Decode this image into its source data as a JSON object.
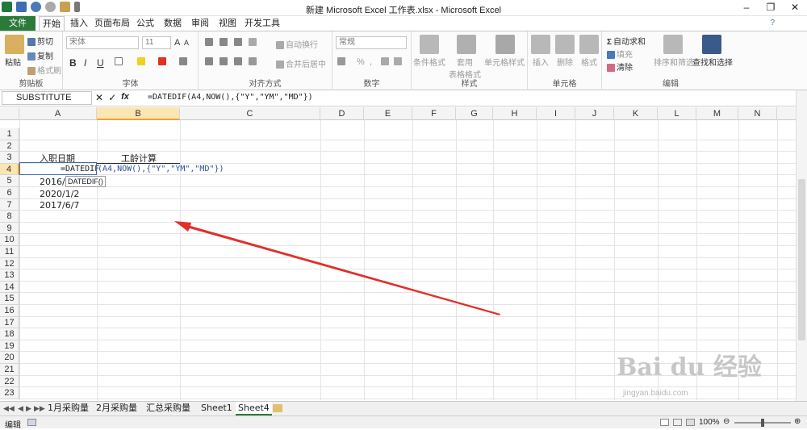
{
  "window": {
    "title": "新建 Microsoft Excel 工作表.xlsx - Microsoft Excel",
    "controls": [
      "–",
      "❐",
      "✕"
    ]
  },
  "ribbon_tabs": {
    "file": "文件",
    "tabs": [
      "开始",
      "插入",
      "页面布局",
      "公式",
      "数据",
      "审阅",
      "视图",
      "开发工具"
    ],
    "active": "开始"
  },
  "clipboard": {
    "paste": "粘贴",
    "cut": "剪切",
    "copy": "复制",
    "format_painter": "格式刷",
    "group": "剪贴板"
  },
  "font": {
    "name": "宋体",
    "size": "11",
    "bold": "B",
    "italic": "I",
    "underline": "U",
    "grow": "A",
    "shrink": "A",
    "group": "字体"
  },
  "alignment": {
    "wrap": "自动换行",
    "merge": "合并后居中",
    "group": "对齐方式"
  },
  "number": {
    "format": "常规",
    "percent": "%",
    "comma": ",",
    "group": "数字"
  },
  "styles": {
    "conditional": "条件格式",
    "table": "套用\n表格格式",
    "cell": "单元格样式",
    "group": "样式"
  },
  "cells": {
    "insert": "插入",
    "delete": "删除",
    "format": "格式",
    "group": "单元格"
  },
  "editing": {
    "autosum": "自动求和",
    "fill": "填充",
    "clear": "清除",
    "sort": "排序和筛选",
    "find": "查找和选择",
    "group": "编辑"
  },
  "formula_bar": {
    "name_box": "SUBSTITUTE",
    "fx": "fx",
    "formula": "=DATEDIF(A4,NOW(),{\"Y\",\"YM\",\"MD\"})"
  },
  "columns": [
    "A",
    "B",
    "C",
    "D",
    "E",
    "F",
    "G",
    "H",
    "I",
    "J",
    "K",
    "L",
    "M",
    "N"
  ],
  "rows": [
    "1",
    "2",
    "3",
    "4",
    "5",
    "6",
    "7",
    "8",
    "9",
    "10",
    "11",
    "12",
    "13",
    "14",
    "15",
    "16",
    "17",
    "18",
    "19",
    "20",
    "21",
    "22",
    "23"
  ],
  "cells_data": {
    "a3": "入职日期",
    "b3": "工龄计算",
    "a4_formula_start": "=DATEDIF",
    "a4_formula_rest": "(A4,NOW(),{\"Y\",\"YM\",\"MD\"})",
    "a5": "2016/4",
    "a6": "2020/1/2",
    "a7": "2017/6/7",
    "tooltip": "DATEDIF()"
  },
  "sheets": {
    "tabs": [
      "1月采购量",
      "2月采购量",
      "汇总采购量",
      "Sheet1",
      "Sheet4"
    ],
    "active": "Sheet4"
  },
  "status": {
    "mode": "编辑",
    "zoom": "100%"
  },
  "watermark": {
    "text": "Bai du 经验",
    "sub": "jingyan.baidu.com"
  },
  "colors": {
    "accent": "#2a7a3a",
    "selection": "#fbe5b0",
    "arrow": "#e0302a"
  }
}
